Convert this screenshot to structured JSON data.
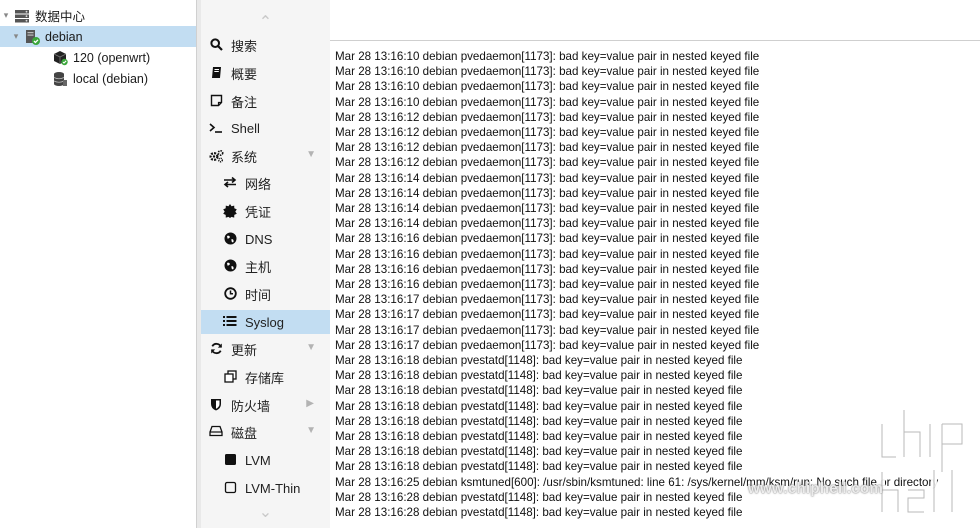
{
  "tree": {
    "datacenter": {
      "label": "数据中心",
      "icon": "server-stack-icon"
    },
    "node": {
      "label": "debian",
      "icon": "node-server-icon",
      "status_color": "#3aa63a"
    },
    "children": [
      {
        "label": "120 (openwrt)",
        "icon": "container-cube-icon",
        "status_color": "#3aa63a"
      },
      {
        "label": "local (debian)",
        "icon": "storage-database-icon"
      }
    ]
  },
  "nav": {
    "items": [
      {
        "label": "搜索",
        "icon": "search-icon"
      },
      {
        "label": "概要",
        "icon": "book-icon"
      },
      {
        "label": "备注",
        "icon": "note-icon"
      },
      {
        "label": "Shell",
        "icon": "terminal-icon"
      },
      {
        "label": "系统",
        "icon": "gears-icon",
        "has_expander": true
      },
      {
        "label": "网络",
        "icon": "exchange-arrows-icon",
        "sub": true
      },
      {
        "label": "凭证",
        "icon": "certificate-icon",
        "sub": true
      },
      {
        "label": "DNS",
        "icon": "globe-icon",
        "sub": true
      },
      {
        "label": "主机",
        "icon": "globe-icon",
        "sub": true
      },
      {
        "label": "时间",
        "icon": "clock-icon",
        "sub": true
      },
      {
        "label": "Syslog",
        "icon": "list-icon",
        "sub": true,
        "active": true
      },
      {
        "label": "更新",
        "icon": "refresh-icon",
        "has_expander": true
      },
      {
        "label": "存储库",
        "icon": "copy-icon",
        "sub": true
      },
      {
        "label": "防火墙",
        "icon": "shield-icon",
        "has_expander": true,
        "expander_right": true
      },
      {
        "label": "磁盘",
        "icon": "hdd-icon",
        "has_expander": true
      },
      {
        "label": "LVM",
        "icon": "square-filled-icon",
        "sub": true
      },
      {
        "label": "LVM-Thin",
        "icon": "square-outline-icon",
        "sub": true
      }
    ],
    "active_color": "#c2ddf2"
  },
  "log": {
    "lines": [
      "Mar 28 13:16:10 debian pvedaemon[1173]: bad key=value pair in nested keyed file",
      "Mar 28 13:16:10 debian pvedaemon[1173]: bad key=value pair in nested keyed file",
      "Mar 28 13:16:10 debian pvedaemon[1173]: bad key=value pair in nested keyed file",
      "Mar 28 13:16:10 debian pvedaemon[1173]: bad key=value pair in nested keyed file",
      "Mar 28 13:16:12 debian pvedaemon[1173]: bad key=value pair in nested keyed file",
      "Mar 28 13:16:12 debian pvedaemon[1173]: bad key=value pair in nested keyed file",
      "Mar 28 13:16:12 debian pvedaemon[1173]: bad key=value pair in nested keyed file",
      "Mar 28 13:16:12 debian pvedaemon[1173]: bad key=value pair in nested keyed file",
      "Mar 28 13:16:14 debian pvedaemon[1173]: bad key=value pair in nested keyed file",
      "Mar 28 13:16:14 debian pvedaemon[1173]: bad key=value pair in nested keyed file",
      "Mar 28 13:16:14 debian pvedaemon[1173]: bad key=value pair in nested keyed file",
      "Mar 28 13:16:14 debian pvedaemon[1173]: bad key=value pair in nested keyed file",
      "Mar 28 13:16:16 debian pvedaemon[1173]: bad key=value pair in nested keyed file",
      "Mar 28 13:16:16 debian pvedaemon[1173]: bad key=value pair in nested keyed file",
      "Mar 28 13:16:16 debian pvedaemon[1173]: bad key=value pair in nested keyed file",
      "Mar 28 13:16:16 debian pvedaemon[1173]: bad key=value pair in nested keyed file",
      "Mar 28 13:16:17 debian pvedaemon[1173]: bad key=value pair in nested keyed file",
      "Mar 28 13:16:17 debian pvedaemon[1173]: bad key=value pair in nested keyed file",
      "Mar 28 13:16:17 debian pvedaemon[1173]: bad key=value pair in nested keyed file",
      "Mar 28 13:16:17 debian pvedaemon[1173]: bad key=value pair in nested keyed file",
      "Mar 28 13:16:18 debian pvestatd[1148]: bad key=value pair in nested keyed file",
      "Mar 28 13:16:18 debian pvestatd[1148]: bad key=value pair in nested keyed file",
      "Mar 28 13:16:18 debian pvestatd[1148]: bad key=value pair in nested keyed file",
      "Mar 28 13:16:18 debian pvestatd[1148]: bad key=value pair in nested keyed file",
      "Mar 28 13:16:18 debian pvestatd[1148]: bad key=value pair in nested keyed file",
      "Mar 28 13:16:18 debian pvestatd[1148]: bad key=value pair in nested keyed file",
      "Mar 28 13:16:18 debian pvestatd[1148]: bad key=value pair in nested keyed file",
      "Mar 28 13:16:18 debian pvestatd[1148]: bad key=value pair in nested keyed file",
      "Mar 28 13:16:25 debian ksmtuned[600]: /usr/sbin/ksmtuned: line 61: /sys/kernel/mm/ksm/run: No such file or directory",
      "Mar 28 13:16:28 debian pvestatd[1148]: bad key=value pair in nested keyed file",
      "Mar 28 13:16:28 debian pvestatd[1148]: bad key=value pair in nested keyed file"
    ]
  },
  "watermark": {
    "url": "www.chiphell.com",
    "logo_text": "chip hell"
  }
}
